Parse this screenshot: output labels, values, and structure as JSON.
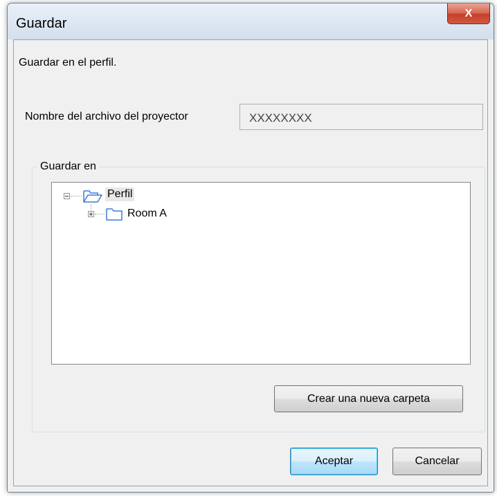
{
  "window": {
    "title": "Guardar",
    "close_label": "X"
  },
  "dialog": {
    "description": "Guardar en el perfil.",
    "projector_file_label": "Nombre del archivo del proyector",
    "projector_file_value": "XXXXXXXX",
    "group_label": "Guardar en"
  },
  "tree": {
    "root": {
      "label": "Perfil",
      "expanded": true,
      "selected": true,
      "icon": "folder-open-icon"
    },
    "children": [
      {
        "label": "Room A",
        "expanded": false,
        "icon": "folder-icon"
      }
    ]
  },
  "buttons": {
    "new_folder": "Crear una nueva carpeta",
    "accept": "Aceptar",
    "cancel": "Cancelar"
  },
  "colors": {
    "close_button": "#c6402a",
    "default_button_border": "#3c7fb1",
    "selection": "#e8e8e8"
  }
}
